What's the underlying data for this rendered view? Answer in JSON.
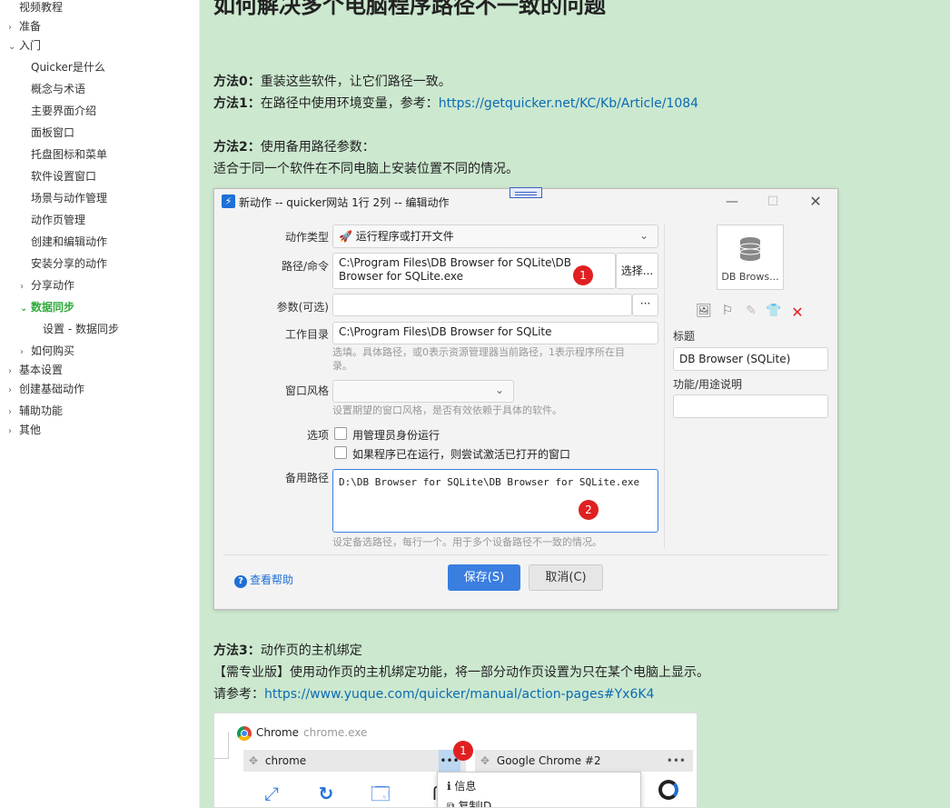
{
  "sidebar": {
    "items": [
      {
        "label": "视频教程",
        "chev": ""
      },
      {
        "label": "准备",
        "chev": "›"
      },
      {
        "label": "入门",
        "chev": "⌄"
      },
      {
        "label": "Quicker是什么",
        "chev": ""
      },
      {
        "label": "概念与术语",
        "chev": ""
      },
      {
        "label": "主要界面介绍",
        "chev": ""
      },
      {
        "label": "面板窗口",
        "chev": ""
      },
      {
        "label": "托盘图标和菜单",
        "chev": ""
      },
      {
        "label": "软件设置窗口",
        "chev": ""
      },
      {
        "label": "场景与动作管理",
        "chev": ""
      },
      {
        "label": "动作页管理",
        "chev": ""
      },
      {
        "label": "创建和编辑动作",
        "chev": ""
      },
      {
        "label": "安装分享的动作",
        "chev": ""
      },
      {
        "label": "分享动作",
        "chev": "›"
      },
      {
        "label": "数据同步",
        "chev": "⌄"
      },
      {
        "label": "设置 - 数据同步",
        "chev": ""
      },
      {
        "label": "如何购买",
        "chev": "›"
      },
      {
        "label": "基本设置",
        "chev": "›"
      },
      {
        "label": "创建基础动作",
        "chev": "›"
      },
      {
        "label": "辅助功能",
        "chev": "›"
      },
      {
        "label": "其他",
        "chev": "›"
      }
    ]
  },
  "content": {
    "title": "如何解决多个电脑程序路径不一致的问题",
    "m0_label": "方法0：",
    "m0_text": "重装这些软件，让它们路径一致。",
    "m1_label": "方法1：",
    "m1_text": "在路径中使用环境变量，参考：",
    "m1_link": "https://getquicker.net/KC/Kb/Article/1084",
    "m2_label": "方法2：",
    "m2_text": "使用备用路径参数：",
    "m2_desc": "适合于同一个软件在不同电脑上安装位置不同的情况。",
    "m3_label": "方法3：",
    "m3_text": "动作页的主机绑定",
    "m3_desc": "【需专业版】使用动作页的主机绑定功能，将一部分动作页设置为只在某个电脑上显示。",
    "m3_ref": "请参考：",
    "m3_link": "https://www.yuque.com/quicker/manual/action-pages#Yx6K4"
  },
  "dialog": {
    "title": "新动作 -- quicker网站 1行 2列 -- 编辑动作",
    "action_type_label": "动作类型",
    "action_type_value": "运行程序或打开文件",
    "path_label": "路径/命令",
    "path_value_line1": "C:\\Program Files\\DB Browser for SQLite\\DB",
    "path_value_line2": "Browser for SQLite.exe",
    "choose_label": "选择...",
    "params_label": "参数(可选)",
    "more_label": "···",
    "workdir_label": "工作目录",
    "workdir_value": "C:\\Program Files\\DB Browser for SQLite",
    "workdir_hint_line1": "选填。具体路径，或0表示资源管理器当前路径，1表示程序所在目",
    "workdir_hint_line2": "录。",
    "winstyle_label": "窗口风格",
    "winstyle_hint": "设置期望的窗口风格，是否有效依赖于具体的软件。",
    "options_label": "选项",
    "opt_admin": "用管理员身份运行",
    "opt_activate": "如果程序已在运行，则尝试激活已打开的窗口",
    "backup_label": "备用路径",
    "backup_value": "D:\\DB Browser for SQLite\\DB Browser for SQLite.exe",
    "backup_hint": "设定备选路径，每行一个。用于多个设备路径不一致的情况。",
    "badge1": "1",
    "badge2": "2",
    "icon_caption": "DB Brows...",
    "title_label": "标题",
    "title_value": "DB Browser (SQLite)",
    "desc_label": "功能/用途说明",
    "help_label": "查看帮助",
    "save_label": "保存(S)",
    "cancel_label": "取消(C)"
  },
  "chrome": {
    "app_name": "Chrome",
    "exe_name": "chrome.exe",
    "tab1": "chrome",
    "tab2": "Google Chrome #2",
    "badge": "1",
    "menu_info": "信息",
    "menu_copy": "复制ID"
  }
}
